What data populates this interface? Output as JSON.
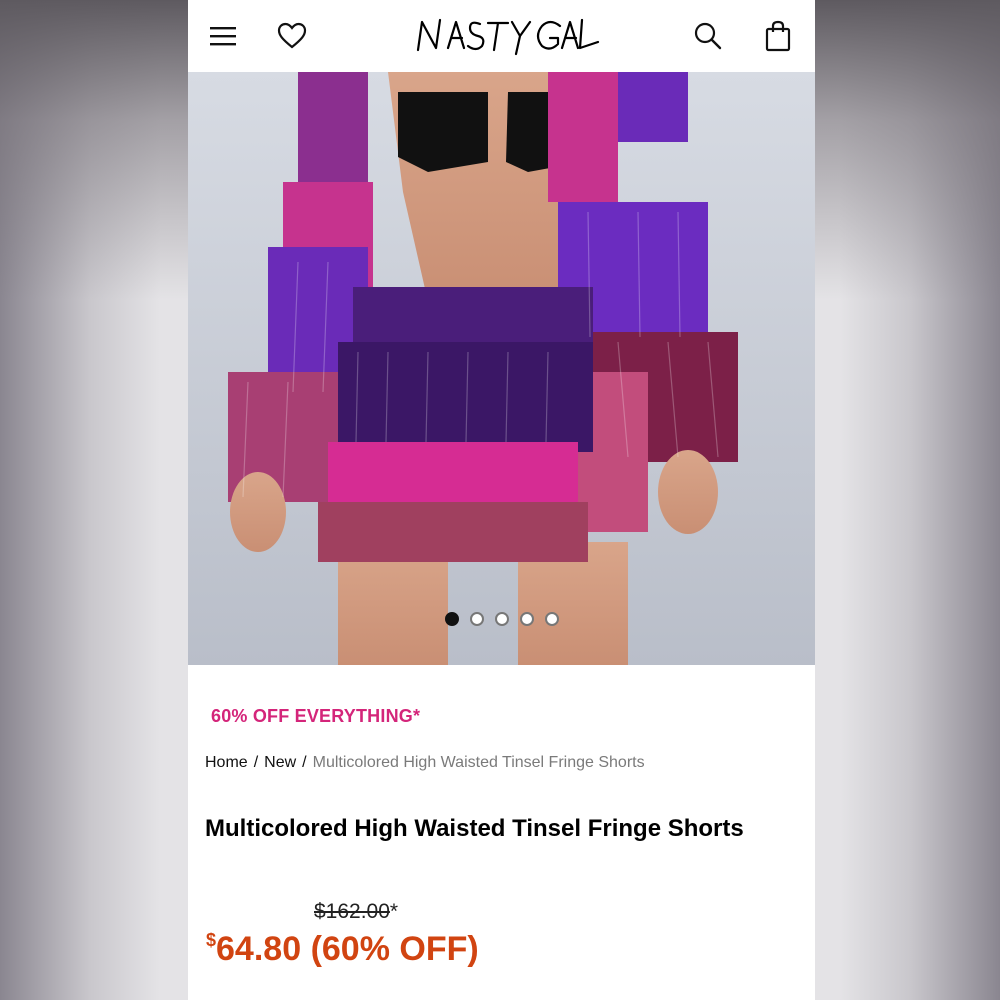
{
  "header": {
    "menu_icon": "hamburger-menu-icon",
    "wishlist_icon": "heart-icon",
    "logo_text": "NASTY GAL",
    "search_icon": "search-icon",
    "bag_icon": "shopping-bag-icon"
  },
  "gallery": {
    "image_count": 5,
    "active_index": 0
  },
  "promo": {
    "text": "60% OFF EVERYTHING*",
    "color": "#d4257a"
  },
  "breadcrumb": {
    "items": [
      "Home",
      "New",
      "Multicolored High Waisted Tinsel Fringe Shorts"
    ],
    "separator": "/"
  },
  "product": {
    "title": "Multicolored High Waisted Tinsel Fringe Shorts",
    "original_price": "$162.00",
    "original_suffix": "*",
    "sale_currency": "$",
    "sale_price": "64.80",
    "discount": "(60% OFF)",
    "sale_color": "#d14411"
  }
}
